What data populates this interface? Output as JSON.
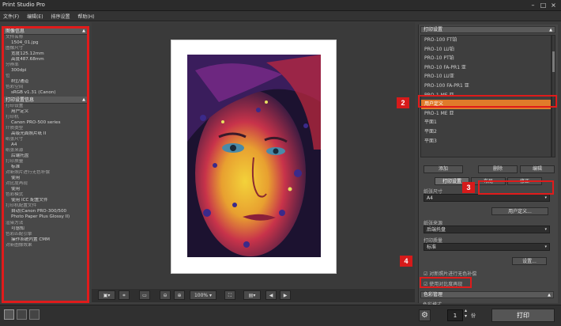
{
  "app": {
    "title": "Print Studio Pro"
  },
  "menu": [
    "文件(F)",
    "编辑(E)",
    "排序设置",
    "帮助(H)"
  ],
  "left_panel": {
    "section1": "图像信息",
    "section1_rows": [
      {
        "k": "文件名称",
        "v": "1504_01.jpg"
      },
      {
        "k": "图像尺寸",
        "v": "宽度125.12mm"
      },
      {
        "k": "",
        "v": "高度487.68mm"
      },
      {
        "k": "分辨率",
        "v": "300dpi"
      },
      {
        "k": "位",
        "v": "8位/通道"
      },
      {
        "k": "色彩空间",
        "v": "sRGB v1.31 (Canon)"
      }
    ],
    "section2": "打印设置信息",
    "section2_rows": [
      {
        "k": "打印设置",
        "v": "用户定义"
      },
      {
        "k": "打印机",
        "v": "Canon PRO-500 series"
      },
      {
        "k": "介质类型",
        "v": "高级光面照片纸 II"
      },
      {
        "k": "纸张尺寸",
        "v": "A4"
      },
      {
        "k": "纸张来源",
        "v": "后端托盘"
      },
      {
        "k": "打印质量",
        "v": "标准"
      },
      {
        "k": "对新照片进行无色补偿",
        "v": "使用"
      },
      {
        "k": "对比度再现",
        "v": "使用"
      },
      {
        "k": "色彩模式",
        "v": "使用 ICC 配置文件"
      },
      {
        "k": "打印机配置文件",
        "v": "自动(Canon PRO-300/500"
      },
      {
        "k": "",
        "v": "Photo Paper Plus Glossy II)"
      },
      {
        "k": "渲染方法",
        "v": "可感知"
      },
      {
        "k": "色彩匹配引擎",
        "v": "操作系统内置 CMM"
      },
      {
        "k": "对新图像效果",
        "v": ""
      }
    ]
  },
  "right_panel": {
    "header": "打印设置",
    "printers": [
      "PRO-100 FT铂",
      "PRO-10 LU铂",
      "PRO-10 PT铂",
      "PRO-10 FA-PR1 亚",
      "PRO-10 LU亚",
      "PRO-100 FA-PR1 亚",
      "PRO-1 ME 亚",
      "用户定义",
      "PRO-1 ME 亚",
      "平面1",
      "平面2",
      "平面3"
    ],
    "selected_printer": "用户定义",
    "btn_add": "添加",
    "btn_delete": "删除",
    "btn_edit": "编辑",
    "tabs": [
      "打印设置",
      "布局",
      "修正"
    ],
    "paper_size_label": "纸张尺寸",
    "paper_size": "A4",
    "user_defined_btn": "用户定义...",
    "paper_source_label": "纸张来源",
    "paper_source": "后端托盘",
    "print_quality_label": "打印质量",
    "print_quality": "标准",
    "settings_btn": "设置...",
    "gray_comp_label": "对新照片进行无色补偿",
    "contrast_label": "使用对比度再现",
    "color_section": "色彩管理",
    "color_mode_label": "色彩模式",
    "color_mode": "使用 ICC 配置文件",
    "printer_profile_label": "打印机配置文件"
  },
  "bottom": {
    "zoom": "100%",
    "copies": "1",
    "copies_unit": "份",
    "print_btn": "打印"
  },
  "badges": [
    "1",
    "2",
    "3",
    "4"
  ],
  "colors": {
    "accent_orange": "#e07b2a",
    "highlight_red": "#e01b1b"
  }
}
